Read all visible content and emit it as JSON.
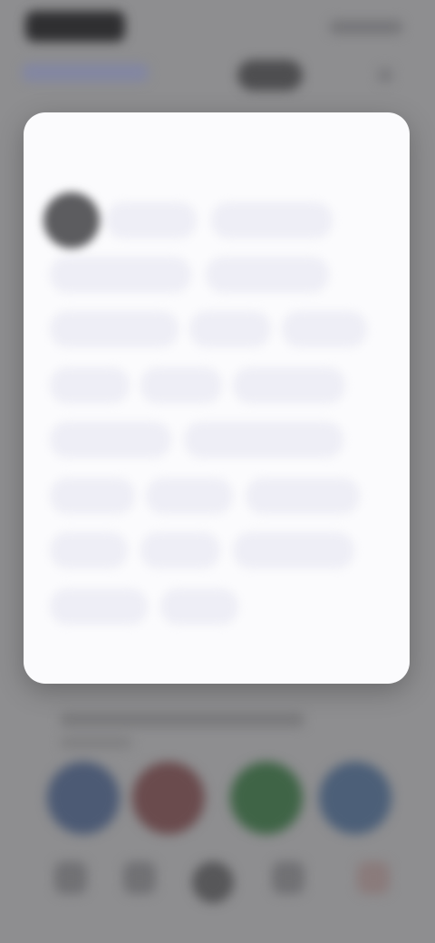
{
  "modal": {
    "title": "",
    "done_label": "",
    "chips": [
      {
        "label": ""
      },
      {
        "label": ""
      },
      {
        "label": ""
      },
      {
        "label": ""
      },
      {
        "label": ""
      },
      {
        "label": ""
      },
      {
        "label": ""
      },
      {
        "label": ""
      },
      {
        "label": ""
      },
      {
        "label": ""
      },
      {
        "label": ""
      },
      {
        "label": ""
      },
      {
        "label": ""
      },
      {
        "label": ""
      },
      {
        "label": ""
      },
      {
        "label": ""
      },
      {
        "label": ""
      },
      {
        "label": ""
      },
      {
        "label": ""
      },
      {
        "label": ""
      }
    ]
  },
  "background": {
    "avatar_colors": [
      "#4c5a74",
      "#6a4b4d",
      "#3f6446",
      "#4c5f78"
    ]
  },
  "colors": {
    "accent": "#4b5ad8",
    "modal_bg": "#fbfbfd",
    "overlay": "#8e8e90"
  },
  "icons": {
    "profile": "avatar-icon",
    "nav": [
      "home-icon",
      "search-icon",
      "create-icon",
      "messages-icon",
      "profile-icon"
    ]
  }
}
